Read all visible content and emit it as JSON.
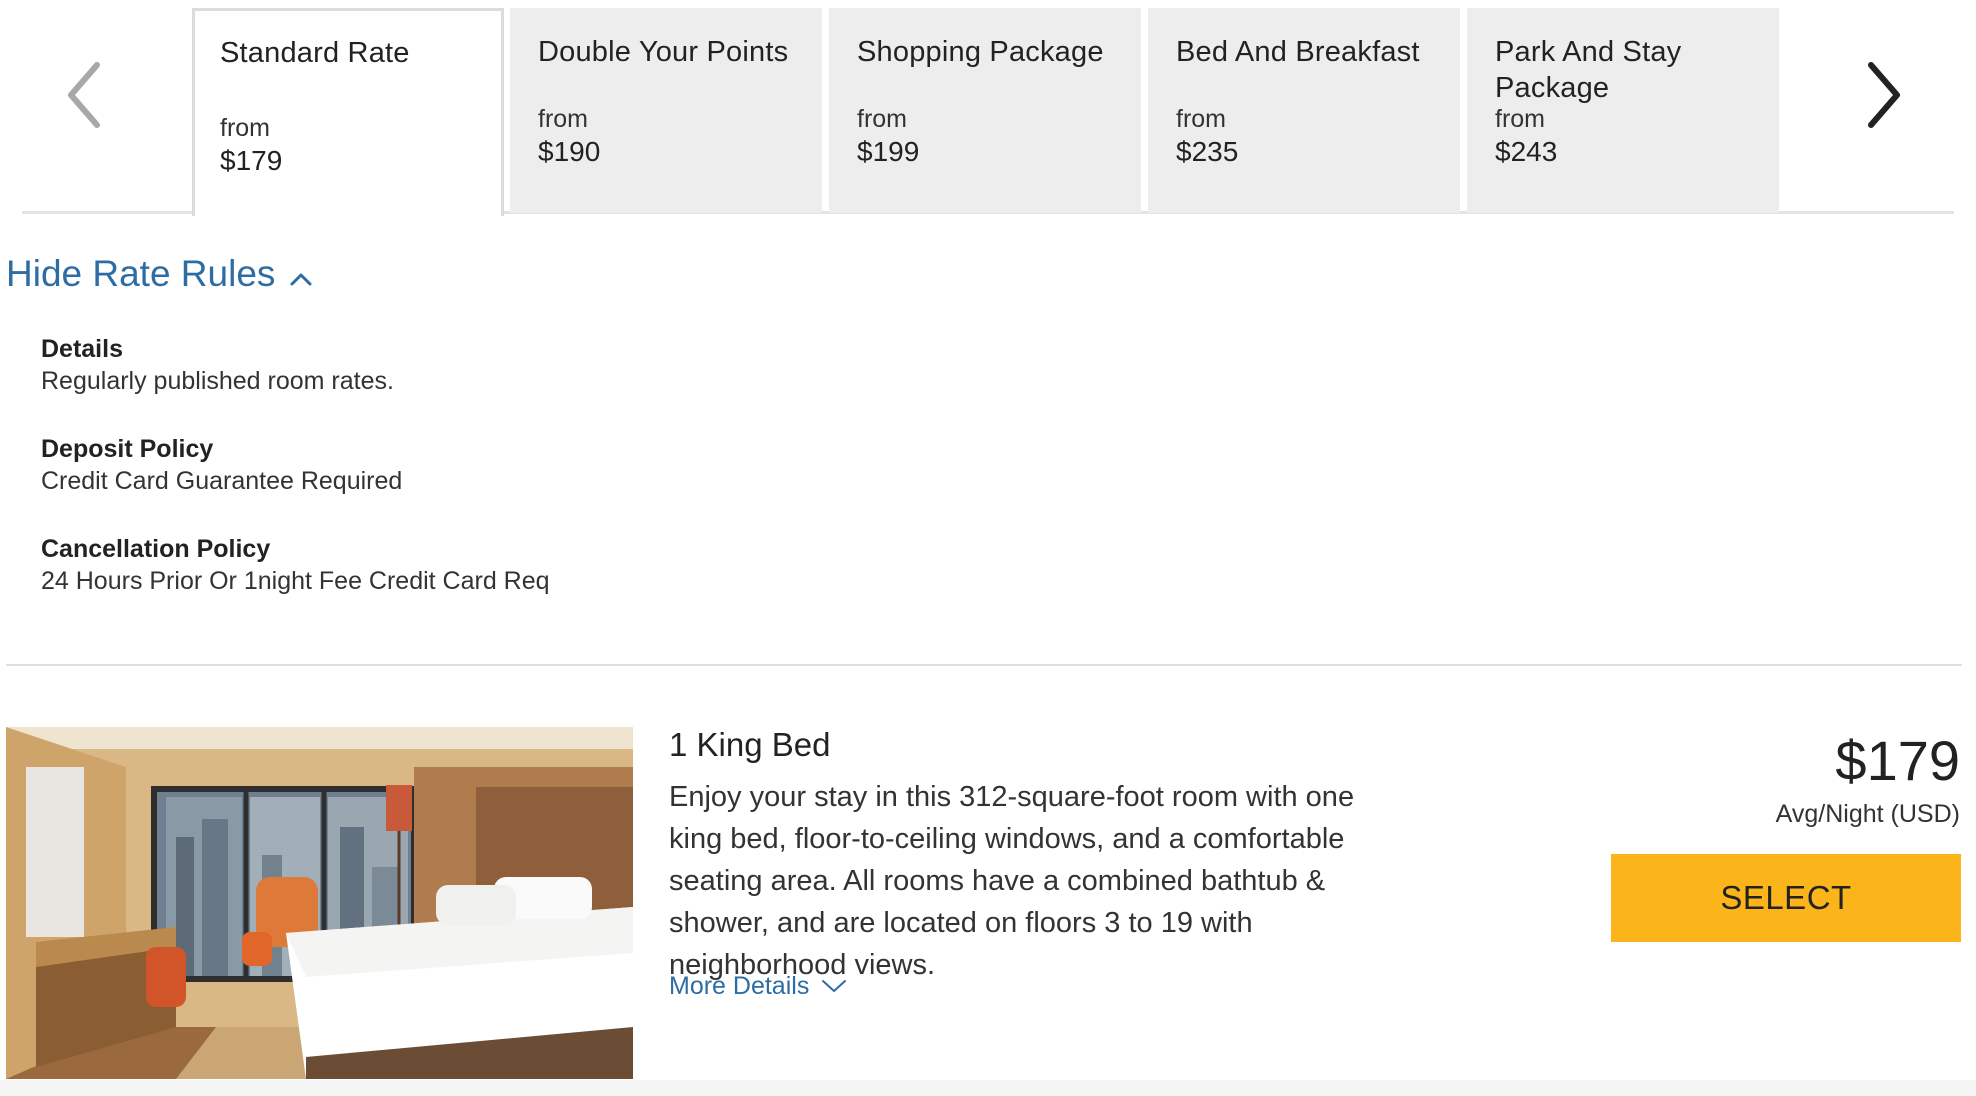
{
  "carousel": {
    "tabs": [
      {
        "name": "Standard Rate",
        "from": "from",
        "price": "$179",
        "active": true
      },
      {
        "name": "Double Your Points",
        "from": "from",
        "price": "$190",
        "active": false
      },
      {
        "name": "Shopping Package",
        "from": "from",
        "price": "$199",
        "active": false
      },
      {
        "name": "Bed And Breakfast",
        "from": "from",
        "price": "$235",
        "active": false
      },
      {
        "name": "Park And Stay Package",
        "from": "from",
        "price": "$243",
        "active": false
      }
    ]
  },
  "rate_rules": {
    "toggle_label": "Hide Rate Rules",
    "items": [
      {
        "title": "Details",
        "text": "Regularly published room rates."
      },
      {
        "title": "Deposit Policy",
        "text": "Credit Card Guarantee Required"
      },
      {
        "title": "Cancellation Policy",
        "text": "24 Hours Prior Or 1night Fee Credit Card Req"
      }
    ]
  },
  "room": {
    "title": "1 King Bed",
    "description": "Enjoy your stay in this 312-square-foot room with one king bed, floor-to-ceiling windows, and a comfortable seating area. All rooms have a combined bathtub & shower, and are located on floors 3 to 19 with neighborhood views.",
    "more_details_label": "More Details",
    "price": "$179",
    "price_unit": "Avg/Night (USD)",
    "select_label": "SELECT"
  },
  "colors": {
    "link": "#2e6ca4",
    "select_button": "#fbb41a",
    "inactive_tab": "#ededed"
  }
}
